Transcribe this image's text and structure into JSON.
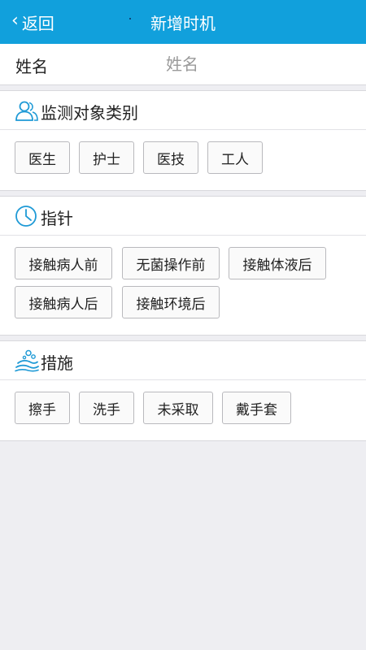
{
  "header": {
    "back_label": "返回",
    "title": "新增时机"
  },
  "name_field": {
    "label": "姓名",
    "placeholder": "姓名"
  },
  "sections": [
    {
      "title": "监测对象类别",
      "icon": "people-icon",
      "options": [
        "医生",
        "护士",
        "医技",
        "工人"
      ]
    },
    {
      "title": "指针",
      "icon": "clock-icon",
      "options": [
        "接触病人前",
        "无菌操作前",
        "接触体液后",
        "接触病人后",
        "接触环境后"
      ]
    },
    {
      "title": "措施",
      "icon": "handwash-icon",
      "options": [
        "擦手",
        "洗手",
        "未采取",
        "戴手套"
      ]
    }
  ],
  "colors": {
    "header_bg": "#11a0dc",
    "icon_blue": "#1f9ad6",
    "page_bg": "#eeeef2"
  }
}
